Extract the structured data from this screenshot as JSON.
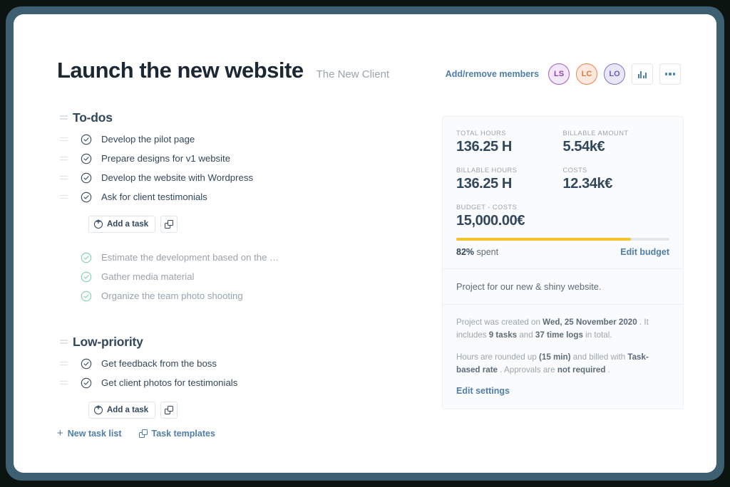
{
  "header": {
    "title": "Launch the new website",
    "client": "The New Client",
    "members_link": "Add/remove members",
    "avatars": [
      {
        "initials": "LS",
        "color": "#8e45b0"
      },
      {
        "initials": "LC",
        "color": "#ea7339"
      },
      {
        "initials": "LO",
        "color": "#6a62bd"
      }
    ],
    "report_icon": "bar-chart-icon",
    "more_icon": "ellipsis-icon"
  },
  "task_lists": [
    {
      "title": "To-dos",
      "tasks": [
        {
          "label": "Develop the pilot page",
          "done": false
        },
        {
          "label": "Prepare designs for v1 website",
          "done": false
        },
        {
          "label": "Develop the website with Wordpress",
          "done": false
        },
        {
          "label": "Ask for client testimonials",
          "done": false
        }
      ],
      "add_label": "Add a task",
      "copy_icon": "duplicate-icon",
      "completed": [
        {
          "label": "Estimate the development based on the …",
          "done": true
        },
        {
          "label": "Gather media material",
          "done": true
        },
        {
          "label": "Organize the team photo shooting",
          "done": true
        }
      ]
    },
    {
      "title": "Low-priority",
      "tasks": [
        {
          "label": "Get feedback from the boss",
          "done": false
        },
        {
          "label": "Get client photos for testimonials",
          "done": false
        }
      ],
      "add_label": "Add a task",
      "copy_icon": "duplicate-icon",
      "completed": []
    }
  ],
  "bottom_links": {
    "new_task_list": "New task list",
    "task_templates": "Task templates",
    "plus_glyph": "+"
  },
  "panel": {
    "stats": [
      {
        "label": "TOTAL HOURS",
        "value": "136.25 H"
      },
      {
        "label": "BILLABLE AMOUNT",
        "value": "5.54k€"
      },
      {
        "label": "BILLABLE HOURS",
        "value": "136.25 H"
      },
      {
        "label": "COSTS",
        "value": "12.34k€"
      }
    ],
    "budget": {
      "label": "BUDGET - COSTS",
      "value": "15,000.00€",
      "percent": 82,
      "spent_pct": "82%",
      "spent_word": "spent",
      "edit_budget": "Edit budget",
      "bar_color": "#f5c22c"
    },
    "description": "Project for our new & shiny website.",
    "meta": {
      "created_pre": "Project was created on ",
      "created_date": "Wed, 25 November 2020",
      "created_mid": " . It includes ",
      "task_count": "9 tasks",
      "and": " and ",
      "log_count": "37 time logs",
      "created_post": " in total.",
      "rounding_pre": "Hours are rounded up ",
      "rounding_val": "(15 min)",
      "rounding_mid": " and billed with ",
      "rate_name": "Task-based rate",
      "rounding_post": " .",
      "approvals_pre": "Approvals are ",
      "approvals_val": "not required",
      "approvals_post": " ."
    },
    "edit_settings": "Edit settings"
  }
}
